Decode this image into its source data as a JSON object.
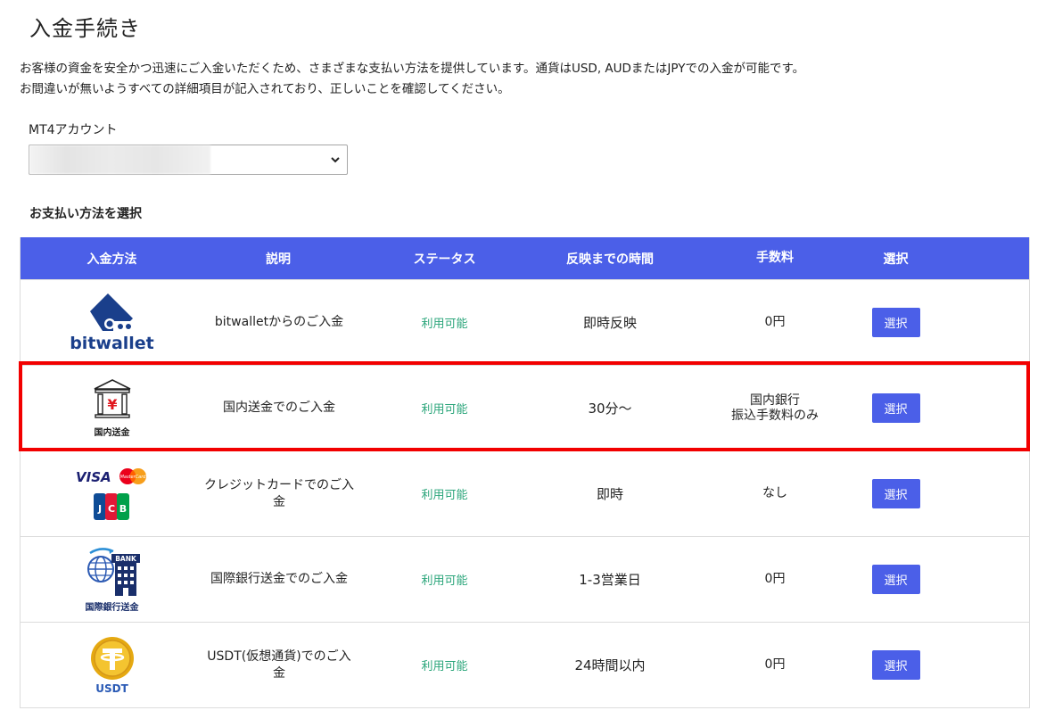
{
  "page": {
    "title": "入金手続き",
    "intro_line1": "お客様の資金を安全かつ迅速にご入金いただくため、さまざまな支払い方法を提供しています。通貨はUSD, AUDまたはJPYでの入金が可能です。",
    "intro_line2": "お間違いが無いようすべての詳細項目が記入されており、正しいことを確認してください。"
  },
  "account": {
    "label": "MT4アカウント",
    "selected_value": ""
  },
  "methods_heading": "お支払い方法を選択",
  "table": {
    "headers": [
      "入金方法",
      "説明",
      "ステータス",
      "反映までの時間",
      "手数料",
      "選択"
    ],
    "rows": [
      {
        "logo": "bitwallet-logo",
        "logo_text": "bitwallet",
        "description": "bitwalletからのご入金",
        "status": "利用可能",
        "time": "即時反映",
        "fee_line1": "0円",
        "fee_line2": "",
        "button": "選択"
      },
      {
        "logo": "domestic-bank-icon",
        "logo_text": "国内送金",
        "description": "国内送金でのご入金",
        "status": "利用可能",
        "time": "30分～",
        "fee_line1": "国内銀行",
        "fee_line2": "振込手数料のみ",
        "button": "選択"
      },
      {
        "logo": "credit-card-logos",
        "logo_text_visa": "VISA",
        "logo_text_mc": "MasterCard",
        "logo_text_jcb": "JCB",
        "description": "クレジットカードでのご入金",
        "status": "利用可能",
        "time": "即時",
        "fee_line1": "なし",
        "fee_line2": "",
        "button": "選択"
      },
      {
        "logo": "international-bank-icon",
        "logo_text": "国際銀行送金",
        "logo_badge": "BANK",
        "description": "国際銀行送金でのご入金",
        "status": "利用可能",
        "time": "1-3営業日",
        "fee_line1": "0円",
        "fee_line2": "",
        "button": "選択"
      },
      {
        "logo": "usdt-coin-icon",
        "logo_text": "USDT",
        "description": "USDT(仮想通貨)でのご入金",
        "status": "利用可能",
        "time": "24時間以内",
        "fee_line1": "0円",
        "fee_line2": "",
        "button": "選択"
      }
    ]
  },
  "colors": {
    "header_bg": "#4b5fe8",
    "button_bg": "#4b5fe8",
    "status_text": "#2aa57a",
    "highlight_border": "#f20000"
  }
}
